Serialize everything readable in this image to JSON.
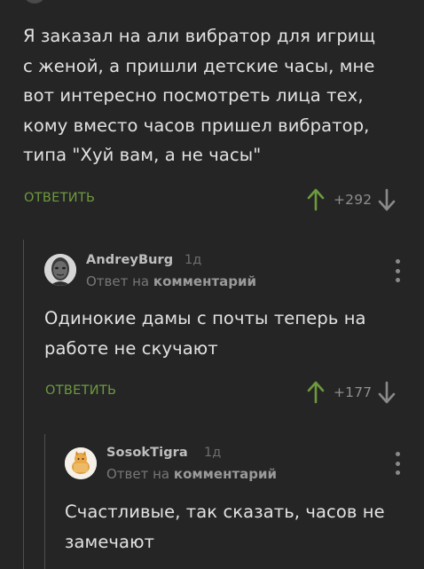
{
  "comments": [
    {
      "text": "Я заказал на али вибратор для игрищ\nс женой, а пришли детские часы, мне\nвот интересно посмотреть лица тех,\nкому вместо часов пришел вибратор,\nтипа \"Хуй вам, а не часы\"",
      "reply_label": "ОТВЕТИТЬ",
      "rating": "+292"
    },
    {
      "username": "AndreyBurg",
      "time": "1д",
      "reply_to_prefix": "Ответ на",
      "reply_to_target": "комментарий",
      "text": "Одинокие дамы с почты теперь на\nработе не скучают",
      "reply_label": "ОТВЕТИТЬ",
      "rating": "+177"
    },
    {
      "username": "SosokTigra",
      "time": "1д",
      "reply_to_prefix": "Ответ на",
      "reply_to_target": "комментарий",
      "text": "Счастливые, так сказать, часов не\nзамечают"
    }
  ],
  "colors": {
    "background": "#252526",
    "accent_green": "#6d9a3d",
    "text": "#e2e2e2",
    "muted": "#8e8e8e"
  },
  "icons": [
    "upvote-arrow-icon",
    "downvote-arrow-icon",
    "more-vertical-icon"
  ]
}
